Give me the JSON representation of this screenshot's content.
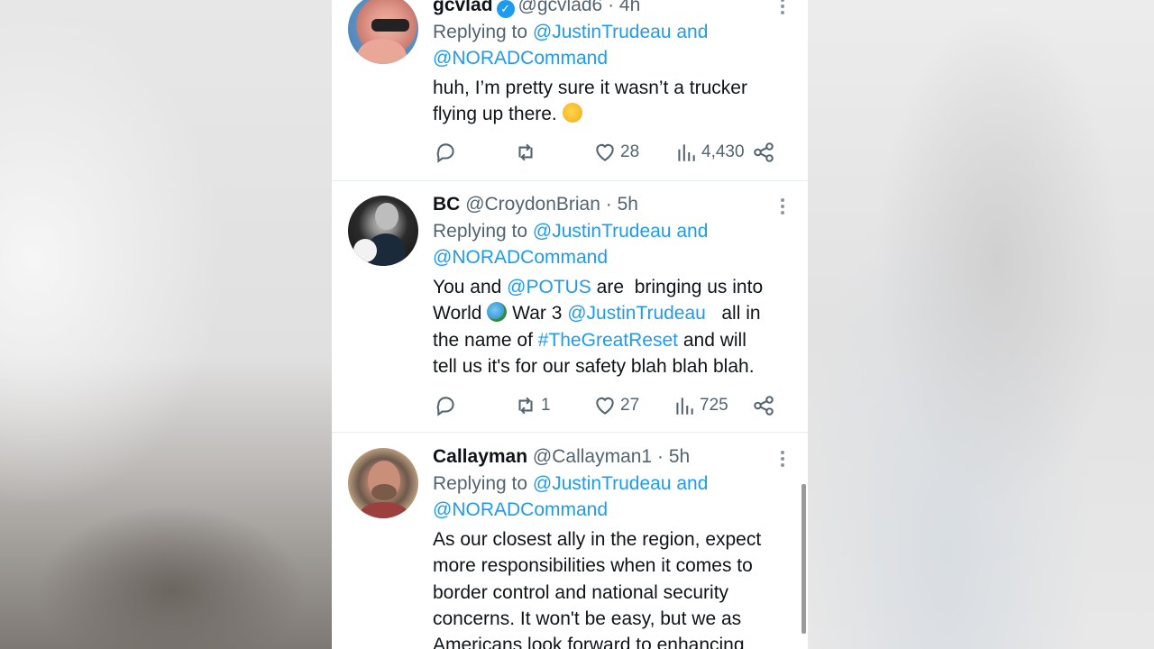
{
  "tweets": [
    {
      "name": "gcvlad",
      "verified": true,
      "handle": "@gcvlad6",
      "sep": "·",
      "time": "4h",
      "replying_label": "Replying to",
      "reply_to_1": "@JustinTrudeau",
      "reply_and": "and",
      "reply_to_2": "@NORADCommand",
      "text_line1": "huh, I’m pretty sure it wasn’t a trucker",
      "text_line2": "flying up there.",
      "retweets": "",
      "likes": "28",
      "views": "4,430"
    },
    {
      "name": "BC",
      "handle": "@CroydonBrian",
      "sep": "·",
      "time": "5h",
      "replying_label": "Replying to",
      "reply_to_1": "@JustinTrudeau",
      "reply_and": "and",
      "reply_to_2": "@NORADCommand",
      "text_a": "You and",
      "mention_a": "@POTUS",
      "text_b": "are  bringing us into",
      "text_c": "World",
      "text_d": "War 3",
      "mention_b": "@JustinTrudeau",
      "text_e": "all in",
      "text_f": "the name of",
      "hashtag": "#TheGreatReset",
      "text_g": "and will",
      "text_h": "tell us it's for our safety blah blah blah.",
      "retweets": "1",
      "likes": "27",
      "views": "725"
    },
    {
      "name": "Callayman",
      "handle": "@Callayman1",
      "sep": "·",
      "time": "5h",
      "replying_label": "Replying to",
      "reply_to_1": "@JustinTrudeau",
      "reply_and": "and",
      "reply_to_2": "@NORADCommand",
      "line1": "As our closest ally in the region, expect",
      "line2": "more responsibilities when it comes to",
      "line3": "border control and national security",
      "line4": "concerns. It won't be easy, but we as",
      "line5": "Americans look forward to enhancing"
    }
  ],
  "colors": {
    "link": "#1d9bf0",
    "text": "#0f1419",
    "muted": "#536471"
  },
  "icons": [
    "reply-icon",
    "retweet-icon",
    "like-icon",
    "views-icon",
    "share-icon",
    "more-icon",
    "verified-icon"
  ]
}
